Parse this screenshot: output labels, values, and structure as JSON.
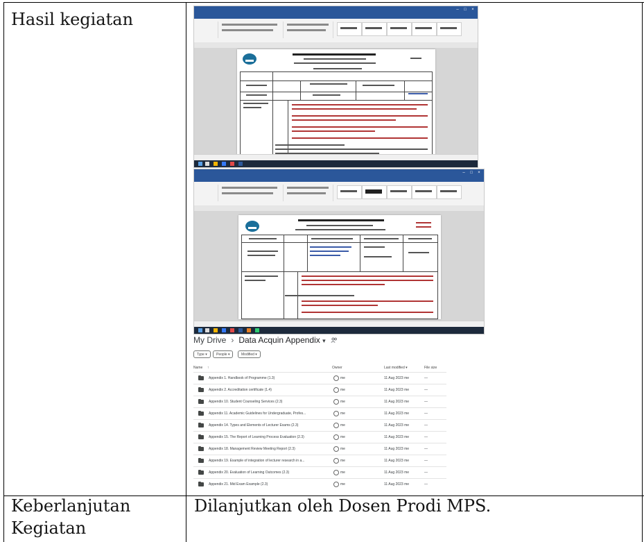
{
  "rows": [
    {
      "label": "Hasil kegiatan"
    },
    {
      "label": "Keberlanjutan Kegiatan",
      "value": "Dilanjutkan oleh Dosen Prodi MPS."
    }
  ],
  "screenshots": {
    "word_window_icons": [
      "minimize-icon",
      "maximize-icon",
      "close-icon"
    ]
  },
  "drive": {
    "breadcrumb": {
      "root": "My Drive",
      "separator": "›",
      "current": "Data Acquin Appendix",
      "dropdown_icon": "▾",
      "shared_icon": "people-icon"
    },
    "filters": [
      "Type ▾",
      "People ▾",
      "Modified ▾"
    ],
    "columns": {
      "name": "Name",
      "sort_icon": "↑",
      "owner": "Owner",
      "modified": "Last modified ▾",
      "size": "File size"
    },
    "files": [
      {
        "name": "Appendix 1. Handbook of Programme (1.3)",
        "owner": "me",
        "modified": "11 Aug 2023 me",
        "size": "—"
      },
      {
        "name": "Appendix 2. Accreditation certificate (1.4)",
        "owner": "me",
        "modified": "11 Aug 2023 me",
        "size": "—"
      },
      {
        "name": "Appendix 10. Student Counseling Services (2.3)",
        "owner": "me",
        "modified": "11 Aug 2023 me",
        "size": "—"
      },
      {
        "name": "Appendix 11. Academic Guidelines for Undergraduate, Profes...",
        "owner": "me",
        "modified": "11 Aug 2023 me",
        "size": "—"
      },
      {
        "name": "Appendix 14. Types and Elements of Lecturer Exams (2.3)",
        "owner": "me",
        "modified": "11 Aug 2023 me",
        "size": "—"
      },
      {
        "name": "Appendix 15. The Report of Learning Process Evaluation (2.3)",
        "owner": "me",
        "modified": "11 Aug 2023 me",
        "size": "—"
      },
      {
        "name": "Appendix 18. Management Review Meeting Report (2.3)",
        "owner": "me",
        "modified": "11 Aug 2023 me",
        "size": "—"
      },
      {
        "name": "Appendix 19. Example of integration of lecturer research in a...",
        "owner": "me",
        "modified": "11 Aug 2023 me",
        "size": "—"
      },
      {
        "name": "Appendix 20. Evaluation of Learning Outcomes (2.3)",
        "owner": "me",
        "modified": "11 Aug 2023 me",
        "size": "—"
      },
      {
        "name": "Appendix 21. Mid Exam Example (2.3)",
        "owner": "me",
        "modified": "11 Aug 2023 me",
        "size": "—"
      }
    ]
  }
}
